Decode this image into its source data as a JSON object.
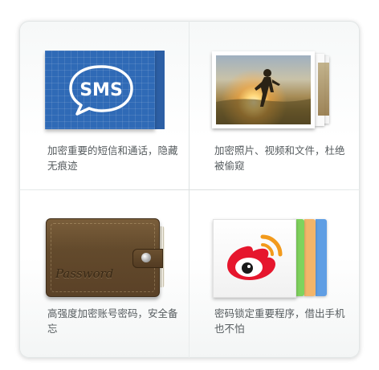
{
  "features": [
    {
      "icon": "sms-icon",
      "icon_text": "SMS",
      "caption": "加密重要的短信和通话，隐藏无痕迹"
    },
    {
      "icon": "photo-icon",
      "caption": "加密照片、视频和文件，杜绝被偷窥"
    },
    {
      "icon": "wallet-password-icon",
      "icon_text": "Password",
      "caption": "高强度加密账号密码，安全备忘"
    },
    {
      "icon": "weibo-app-lock-icon",
      "caption": "密码锁定重要程序，借出手机也不怕"
    }
  ],
  "colors": {
    "sms_blue": "#2f6ab6",
    "wallet_brown": "#634a2c",
    "weibo_red": "#e6162d",
    "weibo_orange": "#f29a1c",
    "caption_text": "#555b5e"
  }
}
